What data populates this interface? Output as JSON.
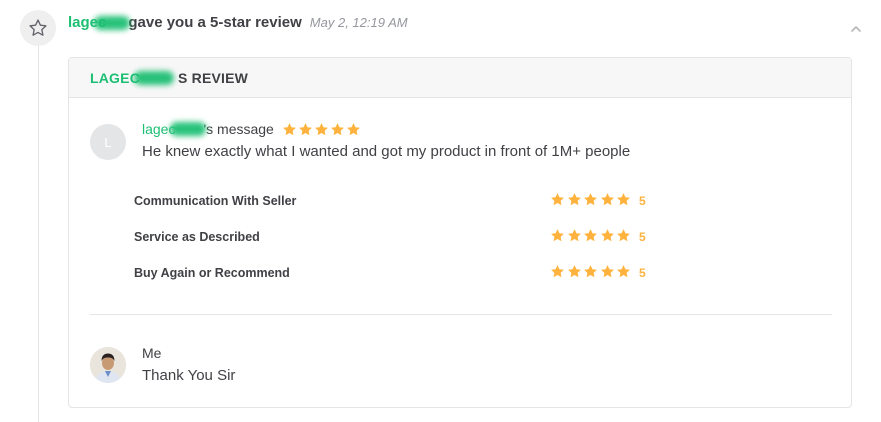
{
  "activity": {
    "username": "lagec",
    "action": "gave you a 5-star review",
    "time": "May 2, 12:19 AM"
  },
  "card": {
    "title_user": "LAGEC",
    "title_suffix": "S REVIEW",
    "buyer_initial": "L",
    "message_user": "lagec",
    "message_label": "'s message",
    "overall_rating": 5,
    "message_text": "He knew exactly what I wanted and got my product in front of 1M+ people",
    "ratings": [
      {
        "label": "Communication With Seller",
        "stars": 5,
        "value": "5"
      },
      {
        "label": "Service as Described",
        "stars": 5,
        "value": "5"
      },
      {
        "label": "Buy Again or Recommend",
        "stars": 5,
        "value": "5"
      }
    ],
    "reply": {
      "name": "Me",
      "text": "Thank You Sir"
    }
  },
  "colors": {
    "brand_green": "#1dbf73",
    "star_yellow": "#ffb33e",
    "text_dark": "#404145",
    "text_muted": "#95979d"
  },
  "icons": {
    "badge": "star-outline-icon",
    "collapse": "chevron-up-icon",
    "rating": "star-filled-icon"
  }
}
